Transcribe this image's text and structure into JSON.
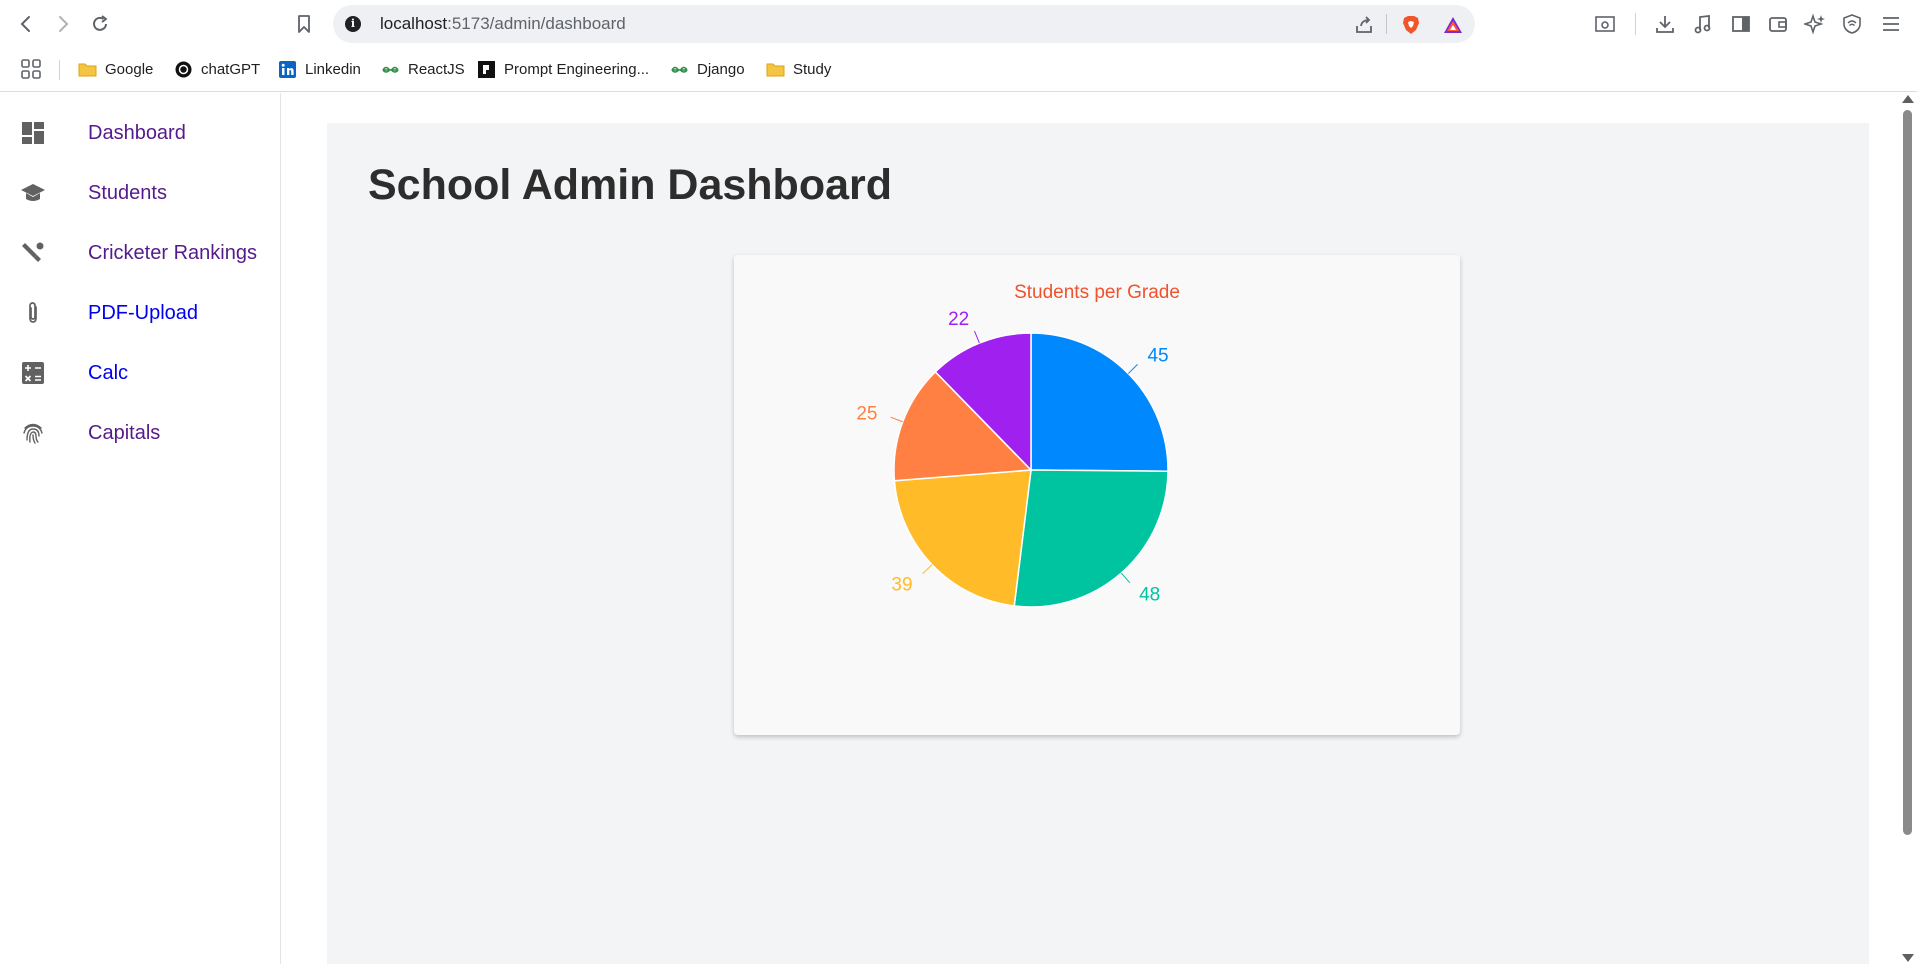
{
  "browser": {
    "url_host": "localhost",
    "url_path": ":5173/admin/dashboard",
    "bookmarks": [
      {
        "label": "Google",
        "icon": "folder-icon"
      },
      {
        "label": "chatGPT",
        "icon": "chatgpt-icon"
      },
      {
        "label": "Linkedin",
        "icon": "linkedin-icon"
      },
      {
        "label": "ReactJS",
        "icon": "geeksforgeeks-icon"
      },
      {
        "label": "Prompt Engineering...",
        "icon": "prompt-icon"
      },
      {
        "label": "Django",
        "icon": "geeksforgeeks-icon"
      },
      {
        "label": "Study",
        "icon": "folder-icon"
      }
    ]
  },
  "sidebar": {
    "items": [
      {
        "label": "Dashboard",
        "icon": "dashboard-icon",
        "state": "visited"
      },
      {
        "label": "Students",
        "icon": "school-icon",
        "state": "visited"
      },
      {
        "label": "Cricketer Rankings",
        "icon": "cricket-icon",
        "state": "visited"
      },
      {
        "label": "PDF-Upload",
        "icon": "attachment-icon",
        "state": "unvisited"
      },
      {
        "label": "Calc",
        "icon": "calculator-icon",
        "state": "unvisited"
      },
      {
        "label": "Capitals",
        "icon": "fingerprint-icon",
        "state": "visited"
      }
    ]
  },
  "main": {
    "title": "School Admin Dashboard"
  },
  "colors": {
    "chart_title": "#f0522d",
    "visited_link": "#551a8b",
    "unvisited_link": "#0000ee"
  },
  "chart_data": {
    "type": "pie",
    "title": "Students per Grade",
    "values": [
      45,
      48,
      39,
      25,
      22
    ],
    "colors": [
      "#0088fe",
      "#00c49f",
      "#ffbb28",
      "#ff8042",
      "#a020f0"
    ],
    "data_labels": [
      "45",
      "48",
      "39",
      "25",
      "22"
    ]
  }
}
